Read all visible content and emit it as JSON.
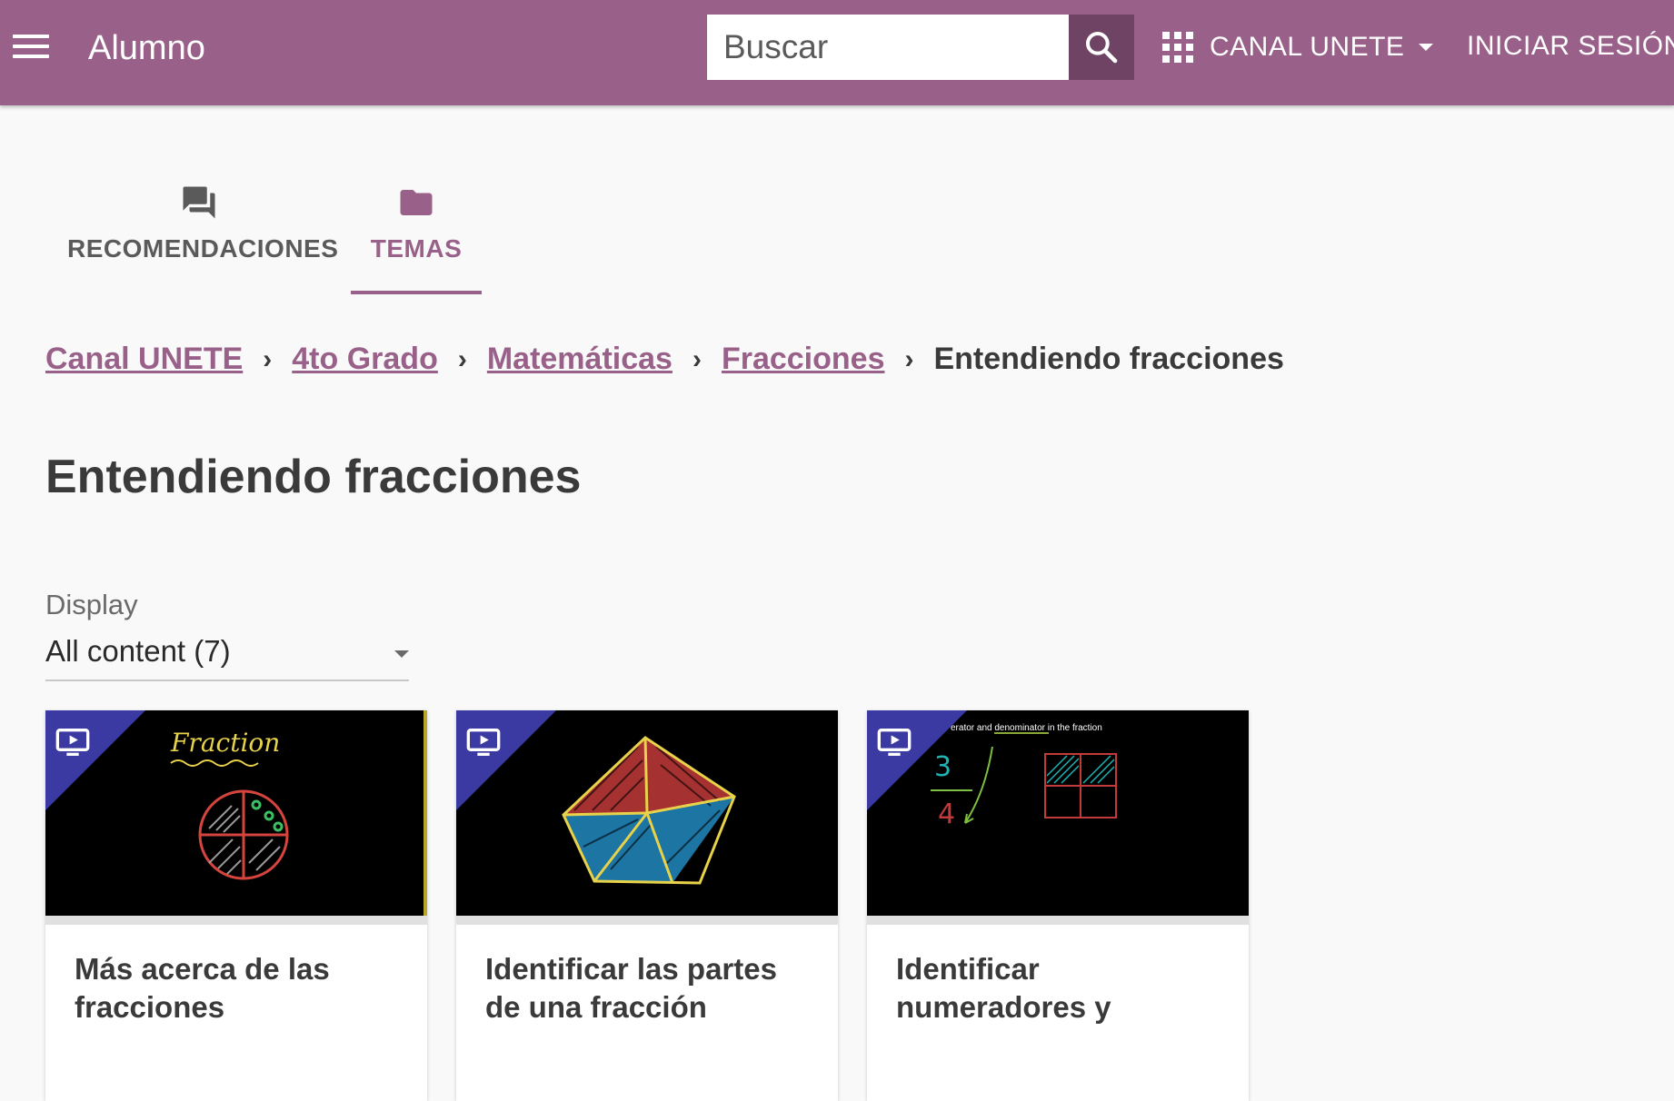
{
  "app_bar": {
    "title": "Alumno",
    "search_placeholder": "Buscar",
    "channel_label": "CANAL UNETE",
    "signin_label": "INICIAR SESIÓN",
    "color": "#996189",
    "search_button_color": "#6e4363"
  },
  "tabs": [
    {
      "label": "RECOMENDACIONES",
      "icon": "forum-icon",
      "active": false
    },
    {
      "label": "TEMAS",
      "icon": "folder-icon",
      "active": true
    }
  ],
  "breadcrumb": {
    "links": [
      "Canal UNETE",
      "4to Grado",
      "Matemáticas",
      "Fracciones"
    ],
    "current": "Entendiendo fracciones",
    "separator": "›"
  },
  "page_title": "Entendiendo fracciones",
  "display": {
    "label": "Display",
    "value": "All content (7)"
  },
  "cards": [
    {
      "title": "Más acerca de las fracciones",
      "kind": "video",
      "thumb_text": "Fraction"
    },
    {
      "title": "Identificar las partes de una fracción",
      "kind": "video",
      "thumb_text": ""
    },
    {
      "title": "Identificar numeradores y",
      "kind": "video",
      "thumb_text": "erator and denominator in the fraction"
    }
  ],
  "colors": {
    "accent": "#996189",
    "ribbon": "#3b3aa3",
    "background": "#f9f9f9"
  }
}
